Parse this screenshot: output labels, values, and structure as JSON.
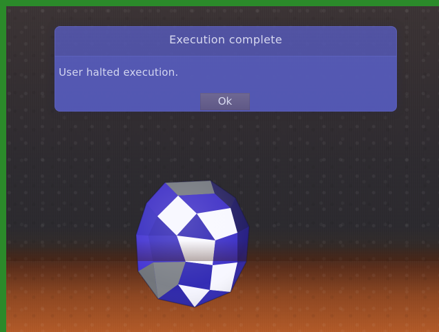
{
  "dialog": {
    "title": "Execution complete",
    "message": "User halted execution.",
    "ok_label": "Ok"
  },
  "colors": {
    "frame": "#2b8a2a",
    "dialog_bg": "#5558b2",
    "dialog_body": "#5a5fbf",
    "button_bg": "#706991",
    "text": "#d7d8ef",
    "ball_blue": "#3429b7",
    "ball_white": "#f8f8ff",
    "ball_gray": "#7a7f86"
  },
  "icons": {
    "ball": "checkered-ball-icon"
  }
}
